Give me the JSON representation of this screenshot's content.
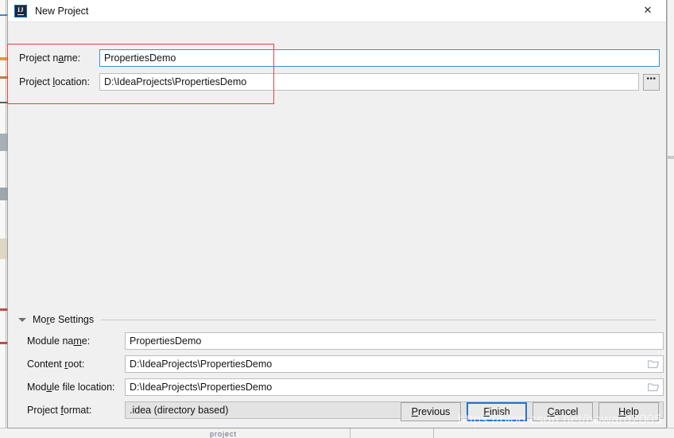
{
  "window": {
    "title": "New Project",
    "app_icon": "intellij-idea-icon",
    "icon_text": "IJ",
    "close_label": "✕"
  },
  "top_form": {
    "rows": [
      {
        "label_pre": "Project n",
        "label_mnemonic": "a",
        "label_post": "me:",
        "value": "PropertiesDemo",
        "focused": true,
        "has_browse": false
      },
      {
        "label_pre": "Project ",
        "label_mnemonic": "l",
        "label_post": "ocation:",
        "value": "D:\\IdeaProjects\\PropertiesDemo",
        "focused": false,
        "has_browse": true
      }
    ],
    "browse_button_label": "•••"
  },
  "annotation": {
    "type": "red-highlight-rectangle",
    "color": "#e8413c"
  },
  "more_settings": {
    "title_pre": "Mo",
    "title_mnemonic": "r",
    "title_post": "e Settings",
    "expanded": true,
    "rows": [
      {
        "label_pre": "Module na",
        "label_mnemonic": "m",
        "label_post": "e:",
        "value": "PropertiesDemo",
        "kind": "text",
        "has_browse": false
      },
      {
        "label_pre": "Content ",
        "label_mnemonic": "r",
        "label_post": "oot:",
        "value": "D:\\IdeaProjects\\PropertiesDemo",
        "kind": "text",
        "has_browse": true
      },
      {
        "label_pre": "Mod",
        "label_mnemonic": "u",
        "label_post": "le file location:",
        "value": "D:\\IdeaProjects\\PropertiesDemo",
        "kind": "text",
        "has_browse": true
      },
      {
        "label_pre": "Project ",
        "label_mnemonic": "f",
        "label_post": "ormat:",
        "value": ".idea (directory based)",
        "kind": "combo",
        "has_browse": false
      }
    ]
  },
  "buttons": [
    {
      "pre": "",
      "mnemonic": "P",
      "post": "revious",
      "primary": false,
      "name": "previous-button"
    },
    {
      "pre": "",
      "mnemonic": "F",
      "post": "inish",
      "primary": true,
      "name": "finish-button"
    },
    {
      "pre": "",
      "mnemonic": "C",
      "post": "ancel",
      "primary": false,
      "name": "cancel-button"
    },
    {
      "pre": "",
      "mnemonic": "H",
      "post": "elp",
      "primary": false,
      "name": "help-button"
    }
  ],
  "watermark": {
    "text": "https://blog.csdn.net/howard2005"
  },
  "colors": {
    "dialog_bg": "#f0f0f0",
    "titlebar_bg": "#ffffff",
    "field_bg": "#ffffff",
    "combo_bg": "#e3e3e3",
    "focus_blue": "#3c8fd4",
    "primary_border": "#2675c4",
    "annotation_red": "#e8413c"
  }
}
